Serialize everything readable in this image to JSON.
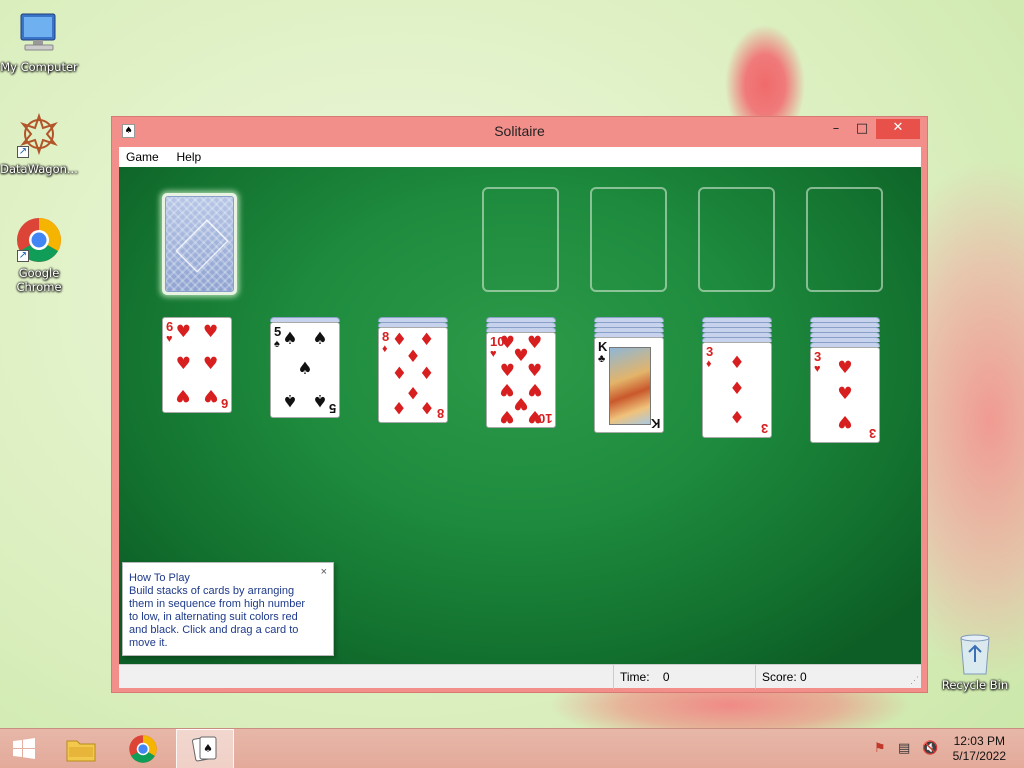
{
  "desktop": {
    "icons": [
      {
        "label": "My Computer",
        "icon": "computer-icon"
      },
      {
        "label": "DataWagon...",
        "icon": "datawagon-icon"
      },
      {
        "label": "Google Chrome",
        "icon": "chrome-icon"
      },
      {
        "label": "Recycle Bin",
        "icon": "recycle-bin-icon"
      }
    ]
  },
  "window": {
    "title": "Solitaire",
    "controls": {
      "minimize": "–",
      "maximize": "□",
      "close": "✕"
    },
    "menu": [
      "Game",
      "Help"
    ],
    "status": {
      "time_label": "Time:",
      "time_value": "0",
      "score_label": "Score: 0"
    }
  },
  "game": {
    "tableau": [
      {
        "hidden": 0,
        "card": {
          "rank": "6",
          "suit": "♥",
          "color": "red"
        }
      },
      {
        "hidden": 1,
        "card": {
          "rank": "5",
          "suit": "♠",
          "color": "black"
        }
      },
      {
        "hidden": 2,
        "card": {
          "rank": "8",
          "suit": "♦",
          "color": "red"
        }
      },
      {
        "hidden": 3,
        "card": {
          "rank": "10",
          "suit": "♥",
          "color": "red"
        }
      },
      {
        "hidden": 4,
        "card": {
          "rank": "K",
          "suit": "♣",
          "color": "black"
        }
      },
      {
        "hidden": 5,
        "card": {
          "rank": "3",
          "suit": "♦",
          "color": "red"
        }
      },
      {
        "hidden": 6,
        "card": {
          "rank": "3",
          "suit": "♥",
          "color": "red"
        }
      }
    ]
  },
  "how_to_play": {
    "heading": "How To Play",
    "lines": [
      "Build stacks of cards by arranging",
      "them in sequence from high number",
      "to low, in alternating suit colors red",
      "and black. Click and drag a card to",
      "move it."
    ],
    "close": "×"
  },
  "taskbar": {
    "time": "12:03 PM",
    "date": "5/17/2022"
  },
  "colors": {
    "felt": "#1d8a3d",
    "window_frame": "#f28f8a",
    "red_suit": "#d81f1f"
  }
}
